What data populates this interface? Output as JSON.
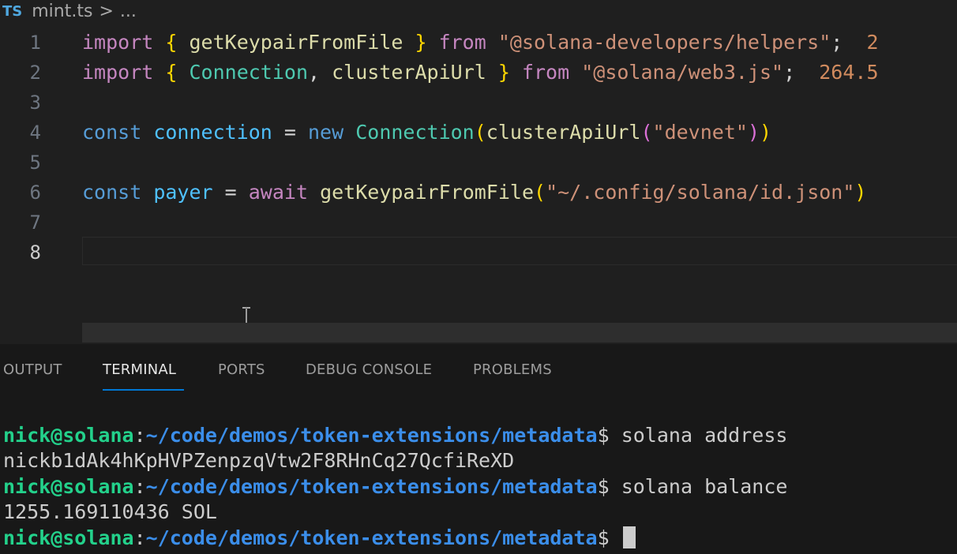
{
  "breadcrumb": {
    "lang_badge": "TS",
    "file": "mint.ts",
    "rest": "..."
  },
  "editor": {
    "lines": [
      {
        "n": "1",
        "tokens": [
          {
            "t": "import",
            "c": "kw2"
          },
          {
            "t": " ",
            "c": "op"
          },
          {
            "t": "{",
            "c": "br"
          },
          {
            "t": " getKeypairFromFile ",
            "c": "fn"
          },
          {
            "t": "}",
            "c": "br"
          },
          {
            "t": " from ",
            "c": "kw2"
          },
          {
            "t": "\"@solana-developers/helpers\"",
            "c": "str"
          },
          {
            "t": ";",
            "c": "op"
          },
          {
            "t": "  2",
            "c": "hint"
          }
        ]
      },
      {
        "n": "2",
        "tokens": [
          {
            "t": "import",
            "c": "kw2"
          },
          {
            "t": " ",
            "c": "op"
          },
          {
            "t": "{",
            "c": "br"
          },
          {
            "t": " Connection",
            "c": "cls"
          },
          {
            "t": ", ",
            "c": "op"
          },
          {
            "t": "clusterApiUrl ",
            "c": "fn"
          },
          {
            "t": "}",
            "c": "br"
          },
          {
            "t": " from ",
            "c": "kw2"
          },
          {
            "t": "\"@solana/web3.js\"",
            "c": "str"
          },
          {
            "t": ";",
            "c": "op"
          },
          {
            "t": "  264.5",
            "c": "hint"
          }
        ]
      },
      {
        "n": "3",
        "tokens": []
      },
      {
        "n": "4",
        "tokens": [
          {
            "t": "const",
            "c": "kw"
          },
          {
            "t": " ",
            "c": "op"
          },
          {
            "t": "connection",
            "c": "var"
          },
          {
            "t": " = ",
            "c": "op"
          },
          {
            "t": "new",
            "c": "kw"
          },
          {
            "t": " ",
            "c": "op"
          },
          {
            "t": "Connection",
            "c": "cls"
          },
          {
            "t": "(",
            "c": "br"
          },
          {
            "t": "clusterApiUrl",
            "c": "fn"
          },
          {
            "t": "(",
            "c": "br2"
          },
          {
            "t": "\"devnet\"",
            "c": "str"
          },
          {
            "t": ")",
            "c": "br2"
          },
          {
            "t": ")",
            "c": "br"
          }
        ]
      },
      {
        "n": "5",
        "tokens": []
      },
      {
        "n": "6",
        "tokens": [
          {
            "t": "const",
            "c": "kw"
          },
          {
            "t": " ",
            "c": "op"
          },
          {
            "t": "payer",
            "c": "var"
          },
          {
            "t": " = ",
            "c": "op"
          },
          {
            "t": "await",
            "c": "kw2"
          },
          {
            "t": " ",
            "c": "op"
          },
          {
            "t": "getKeypairFromFile",
            "c": "fn"
          },
          {
            "t": "(",
            "c": "br"
          },
          {
            "t": "\"~/.config/solana/id.json\"",
            "c": "str"
          },
          {
            "t": ")",
            "c": "br"
          }
        ]
      },
      {
        "n": "7",
        "tokens": []
      },
      {
        "n": "8",
        "tokens": [],
        "active": true
      }
    ]
  },
  "panel": {
    "tabs": [
      {
        "label": "OUTPUT",
        "active": false
      },
      {
        "label": "TERMINAL",
        "active": true
      },
      {
        "label": "PORTS",
        "active": false
      },
      {
        "label": "DEBUG CONSOLE",
        "active": false
      },
      {
        "label": "PROBLEMS",
        "active": false
      }
    ],
    "terminal": {
      "user": "nick@solana",
      "path": "~/code/demos/token-extensions/metadata",
      "prompt_symbol": "$",
      "commands": [
        {
          "cmd": " solana address",
          "output": "nickb1dAk4hKpHVPZenpzqVtw2F8RHnCq27QcfiReXD"
        },
        {
          "cmd": " solana balance",
          "output": "1255.169110436 SOL"
        }
      ],
      "current_cmd": " "
    }
  },
  "colors": {
    "editor_bg": "#1f1f1f",
    "panel_bg": "#181818",
    "accent": "#0078d4",
    "prompt_user": "#23d18b",
    "prompt_path": "#3b8eea"
  }
}
